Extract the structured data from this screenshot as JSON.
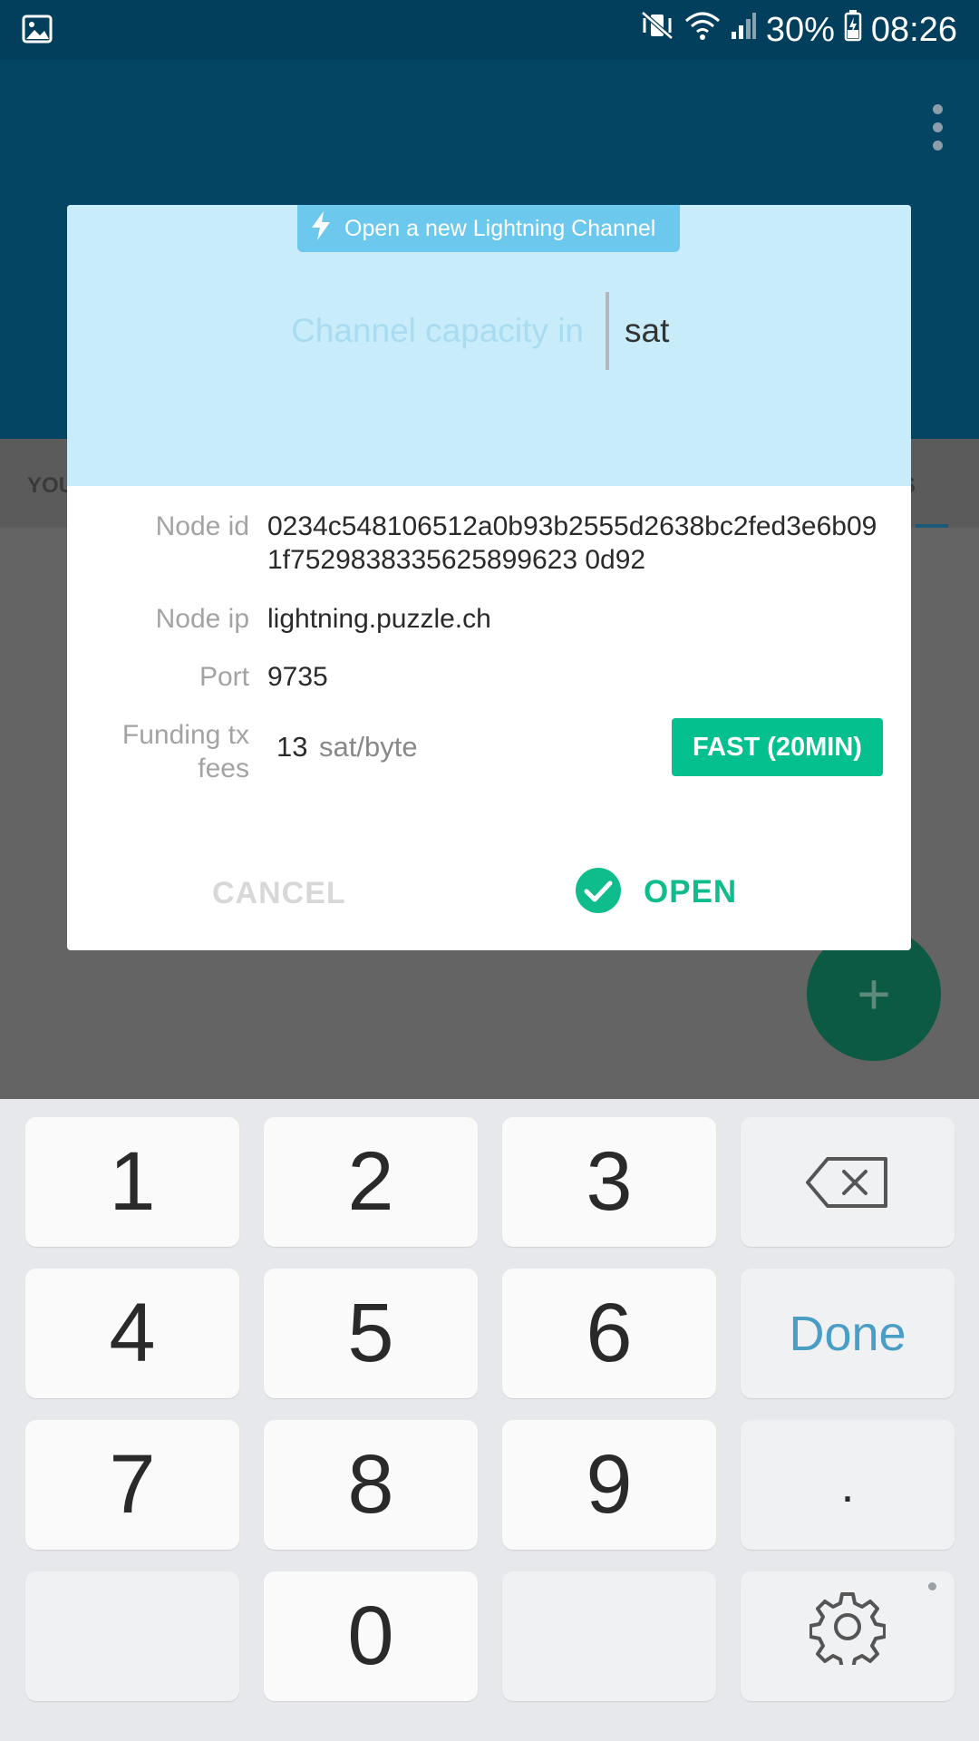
{
  "status_bar": {
    "battery_percent": "30%",
    "time": "08:26"
  },
  "background": {
    "tab_left_partial": "YOU",
    "tab_right_partial": "S",
    "fab_label": "+"
  },
  "dialog": {
    "title": "Open a new Lightning Channel",
    "capacity_placeholder": "Channel capacity in",
    "capacity_unit": "sat",
    "node_id_label": "Node id",
    "node_id_value": "0234c548106512a0b93b2555d2638bc2fed3e6b091f7529838335625899623 0d92",
    "node_ip_label": "Node ip",
    "node_ip_value": "lightning.puzzle.ch",
    "port_label": "Port",
    "port_value": "9735",
    "fees_label_line1": "Funding tx",
    "fees_label_line2": "fees",
    "fees_value": "13",
    "fees_unit": "sat/byte",
    "fee_speed_button": "FAST (20MIN)",
    "cancel_label": "CANCEL",
    "open_label": "OPEN"
  },
  "keyboard": {
    "keys": [
      "1",
      "2",
      "3",
      "4",
      "5",
      "6",
      "7",
      "8",
      "9",
      "0"
    ],
    "done_label": "Done",
    "dot_label": "."
  },
  "colors": {
    "app_bar": "#034563",
    "dialog_header": "#c8ecf9",
    "title_chip": "#6cc8ec",
    "accent_green": "#04c08e",
    "done_blue": "#4a9dc5"
  }
}
